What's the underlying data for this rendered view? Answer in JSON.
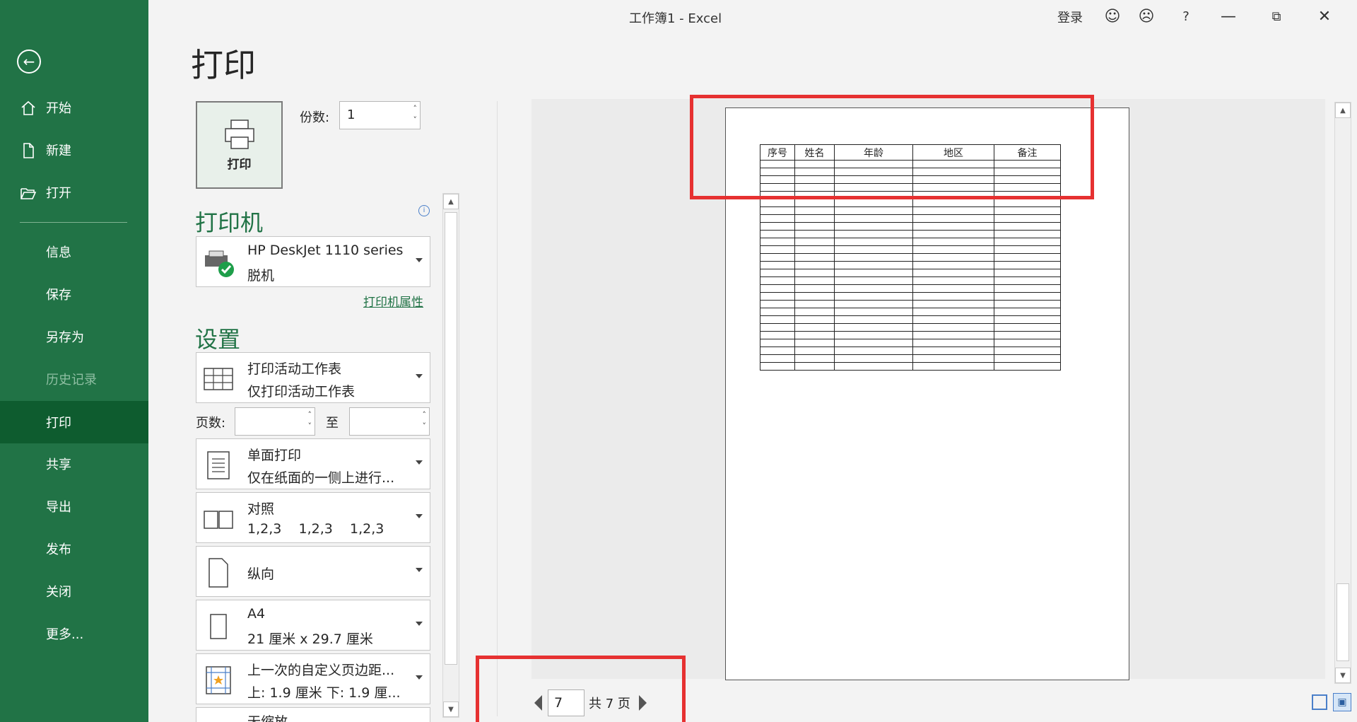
{
  "window": {
    "title": "工作簿1  -  Excel",
    "login": "登录",
    "help": "?"
  },
  "nav": {
    "items": [
      "开始",
      "新建",
      "打开",
      "信息",
      "保存",
      "另存为",
      "历史记录",
      "打印",
      "共享",
      "导出",
      "发布",
      "关闭",
      "更多..."
    ]
  },
  "print": {
    "heading": "打印",
    "button_label": "打印",
    "copies_label": "份数:",
    "copies_value": "1"
  },
  "printer": {
    "section": "打印机",
    "name": "HP DeskJet 1110 series",
    "status": "脱机",
    "properties_link": "打印机属性"
  },
  "settings": {
    "section": "设置",
    "scope": {
      "title": "打印活动工作表",
      "sub": "仅打印活动工作表"
    },
    "pages_label": "页数:",
    "to_label": "至",
    "sides": {
      "title": "单面打印",
      "sub": "仅在纸面的一侧上进行..."
    },
    "collate": {
      "title": "对照",
      "sub": "1,2,3    1,2,3    1,2,3"
    },
    "orientation": {
      "title": "纵向"
    },
    "paper": {
      "title": "A4",
      "sub": "21 厘米 x 29.7 厘米"
    },
    "margins": {
      "title": "上一次的自定义页边距...",
      "sub": "上: 1.9 厘米 下: 1.9 厘..."
    },
    "scaling": {
      "title": "无缩放"
    }
  },
  "preview": {
    "headers": [
      "序号",
      "姓名",
      "年龄",
      "地区",
      "备注"
    ],
    "row_count": 27,
    "current_page": "7",
    "total_text": "共 7 页"
  }
}
